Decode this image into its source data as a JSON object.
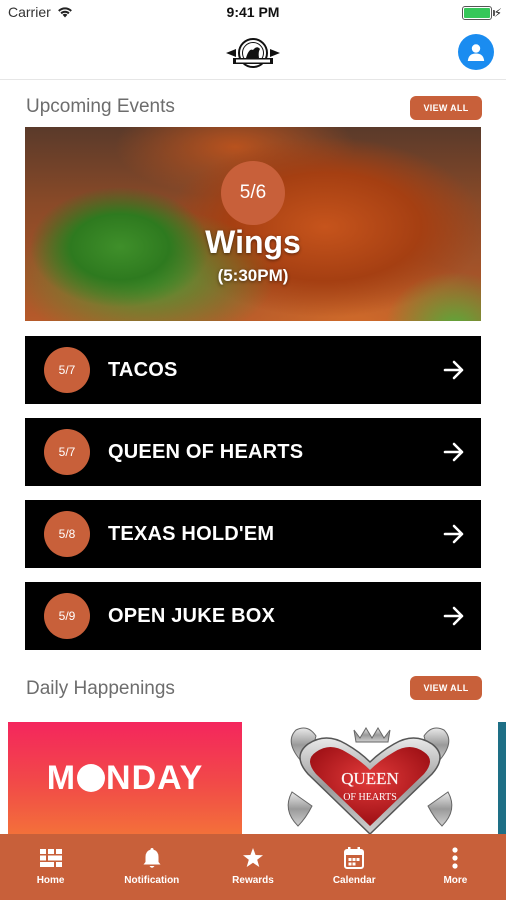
{
  "status_bar": {
    "carrier": "Carrier",
    "time": "9:41 PM"
  },
  "upcoming": {
    "title": "Upcoming Events",
    "view_all": "VIEW ALL",
    "featured": {
      "date": "5/6",
      "title": "Wings",
      "time": "(5:30PM)"
    },
    "events": [
      {
        "date": "5/7",
        "name": "TACOS"
      },
      {
        "date": "5/7",
        "name": "QUEEN OF HEARTS"
      },
      {
        "date": "5/8",
        "name": "TEXAS HOLD'EM"
      },
      {
        "date": "5/9",
        "name": "OPEN JUKE BOX"
      }
    ]
  },
  "daily": {
    "title": "Daily Happenings",
    "view_all": "VIEW ALL",
    "cards": [
      {
        "text_before": "M",
        "text_after": "NDAY"
      },
      {
        "line1": "QUEEN",
        "line2": "OF HEARTS"
      }
    ]
  },
  "tab_bar": {
    "items": [
      {
        "label": "Home",
        "icon": "home-grid-icon"
      },
      {
        "label": "Notification",
        "icon": "bell-icon"
      },
      {
        "label": "Rewards",
        "icon": "star-icon"
      },
      {
        "label": "Calendar",
        "icon": "calendar-icon"
      },
      {
        "label": "More",
        "icon": "more-vertical-icon"
      }
    ]
  },
  "colors": {
    "accent": "#c8603a",
    "profile": "#1a8cf0",
    "battery": "#35c759"
  }
}
